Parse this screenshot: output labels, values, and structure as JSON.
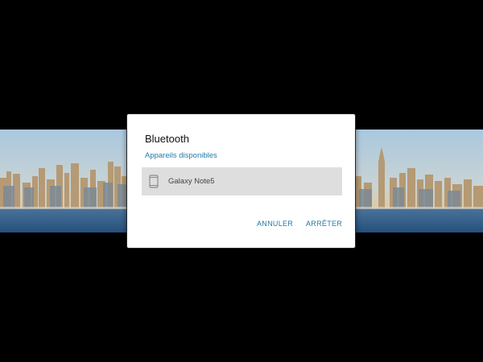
{
  "background": {
    "colors": {
      "screen": "#000000",
      "sky_top": "#aecbdf",
      "sky_bottom": "#e7c79a",
      "water": "#2f5f8c"
    }
  },
  "dialog": {
    "title": "Bluetooth",
    "section_header": "Appareils disponibles",
    "devices": [
      {
        "name": "Galaxy Note5",
        "icon": "phone-icon"
      }
    ],
    "buttons": {
      "cancel": "ANNULER",
      "stop": "ARRÊTER"
    },
    "colors": {
      "accent": "#1f7aa6",
      "row_highlight": "#dedede",
      "surface": "#ffffff"
    }
  }
}
